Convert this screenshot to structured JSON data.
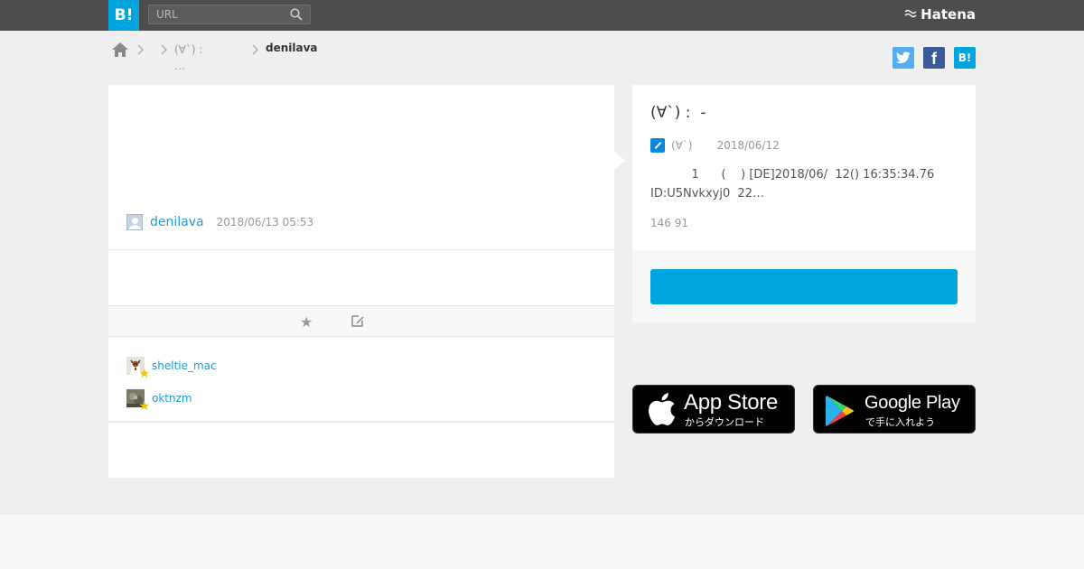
{
  "header": {
    "logo_text": "B!",
    "search_placeholder": "URL",
    "brand": "Hatena"
  },
  "breadcrumb": {
    "category": "(∀`) :\n…",
    "current": "denilava"
  },
  "share": {
    "twitter": "",
    "facebook": "f",
    "hatena": "B!"
  },
  "comment": {
    "username": "denilava",
    "date": "2018/06/13 05:53"
  },
  "stars": [
    {
      "username": "sheltie_mac"
    },
    {
      "username": "oktnzm"
    }
  ],
  "entry": {
    "title": "(∀`) :  -",
    "site": "(∀`)",
    "date": "2018/06/12",
    "excerpt": "           1      (    ) [DE]2018/06/  12() 16:35:34.76\nID:U5Nvkxyj0  22…",
    "counts": "146 91"
  },
  "stores": {
    "apple_title": "App Store",
    "apple_sub": "からダウンロード",
    "google_title": "Google Play",
    "google_sub": "で手に入れよう"
  },
  "colors": {
    "topbar": "#4d4d4d",
    "accent": "#00a4de",
    "link": "#1f9ad6"
  }
}
